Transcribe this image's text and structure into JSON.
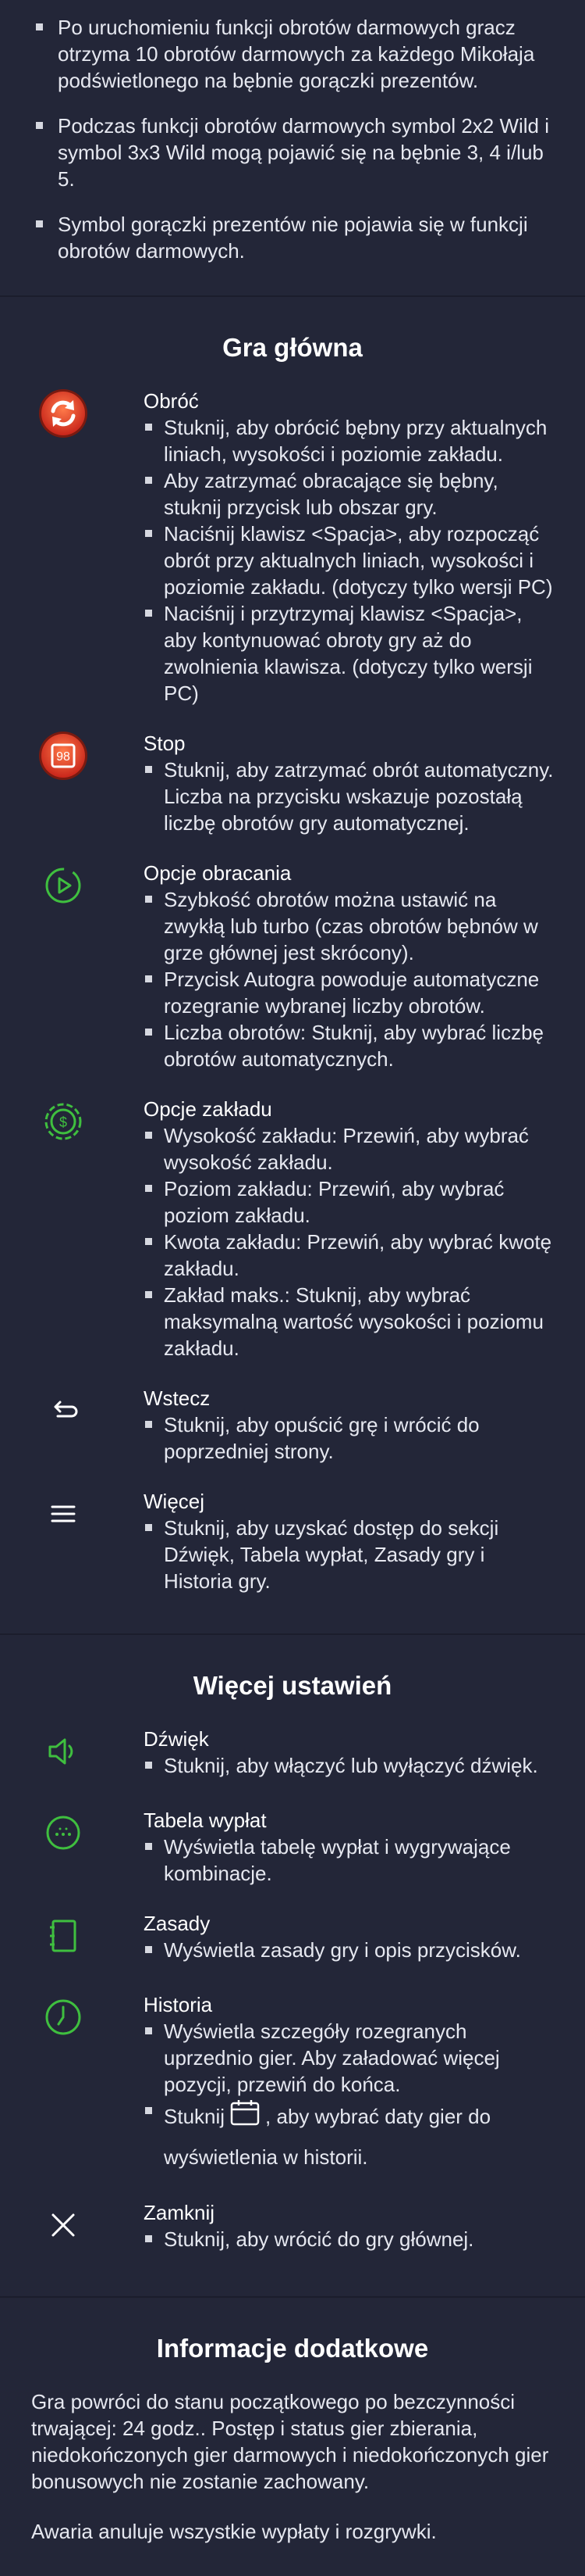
{
  "free_spins_rules": [
    "Po uruchomieniu funkcji obrotów darmowych gracz otrzyma 10 obrotów darmowych za każdego Mikołaja podświetlonego na bębnie gorączki prezentów.",
    "Podczas funkcji obrotów darmowych symbol 2x2 Wild i symbol 3x3 Wild mogą pojawić się na bębnie 3, 4 i/lub 5.",
    "Symbol gorączki prezentów nie pojawia się w funkcji obrotów darmowych."
  ],
  "main_game": {
    "title": "Gra główna",
    "items": [
      {
        "icon": "spin-icon",
        "title": "Obróć",
        "bullets": [
          "Stuknij, aby obrócić bębny przy aktualnych liniach, wysokości i poziomie zakładu.",
          "Aby zatrzymać obracające się bębny, stuknij przycisk lub obszar gry.",
          "Naciśnij klawisz <Spacja>, aby rozpocząć obrót przy aktualnych liniach, wysokości i poziomie zakładu. (dotyczy tylko wersji PC)",
          "Naciśnij i przytrzymaj klawisz <Spacja>, aby kontynuować obroty gry aż do zwolnienia klawisza. (dotyczy tylko wersji PC)"
        ]
      },
      {
        "icon": "stop-icon",
        "icon_label": "98",
        "title": "Stop",
        "bullets": [
          "Stuknij, aby zatrzymać obrót automatyczny. Liczba na przycisku wskazuje pozostałą liczbę obrotów gry automatycznej."
        ]
      },
      {
        "icon": "spin-options-icon",
        "title": "Opcje obracania",
        "bullets": [
          "Szybkość obrotów można ustawić na zwykłą lub turbo (czas obrotów bębnów w grze głównej jest skrócony).",
          "Przycisk Autogra powoduje automatyczne rozegranie wybranej liczby obrotów.",
          "Liczba obrotów: Stuknij, aby wybrać liczbę obrotów automatycznych."
        ]
      },
      {
        "icon": "bet-options-icon",
        "title": "Opcje zakładu",
        "bullets": [
          "Wysokość zakładu: Przewiń, aby wybrać wysokość zakładu.",
          "Poziom zakładu: Przewiń, aby wybrać poziom zakładu.",
          "Kwota zakładu: Przewiń, aby wybrać kwotę zakładu.",
          "Zakład maks.: Stuknij, aby wybrać maksymalną wartość wysokości i poziomu zakładu."
        ]
      },
      {
        "icon": "back-icon",
        "title": "Wstecz",
        "bullets": [
          "Stuknij, aby opuścić grę i wrócić do poprzedniej strony."
        ]
      },
      {
        "icon": "menu-icon",
        "title": "Więcej",
        "bullets": [
          "Stuknij, aby uzyskać dostęp do sekcji Dźwięk, Tabela wypłat, Zasady gry i Historia gry."
        ]
      }
    ]
  },
  "more_settings": {
    "title": "Więcej ustawień",
    "items": [
      {
        "icon": "sound-icon",
        "title": "Dźwięk",
        "bullets": [
          "Stuknij, aby włączyć lub wyłączyć dźwięk."
        ]
      },
      {
        "icon": "paytable-icon",
        "title": "Tabela wypłat",
        "bullets": [
          "Wyświetla tabelę wypłat i wygrywające kombinacje."
        ]
      },
      {
        "icon": "rules-icon",
        "title": "Zasady",
        "bullets": [
          "Wyświetla zasady gry i opis przycisków."
        ]
      },
      {
        "icon": "history-icon",
        "title": "Historia",
        "bullets": [
          "Wyświetla szczegóły rozegranych uprzednio gier. Aby załadować więcej pozycji, przewiń do końca."
        ],
        "calendar_bullet_before": "Stuknij",
        "calendar_bullet_after": ", aby wybrać daty gier do wyświetlenia w historii."
      },
      {
        "icon": "close-icon",
        "title": "Zamknij",
        "bullets": [
          "Stuknij, aby wrócić do gry głównej."
        ]
      }
    ]
  },
  "additional_info": {
    "title": "Informacje dodatkowe",
    "paragraphs": [
      "Gra powróci do stanu początkowego po bezczynności trwającej: 24 godz.. Postęp i status gier zbierania, niedokończonych gier darmowych i niedokończonych gier bonusowych nie zostanie zachowany.",
      "Awaria anuluje wszystkie wypłaty i rozgrywki."
    ]
  },
  "colors": {
    "background": "#232638",
    "accent_green": "#3fbf3f",
    "spin_red": "#e8452a"
  }
}
